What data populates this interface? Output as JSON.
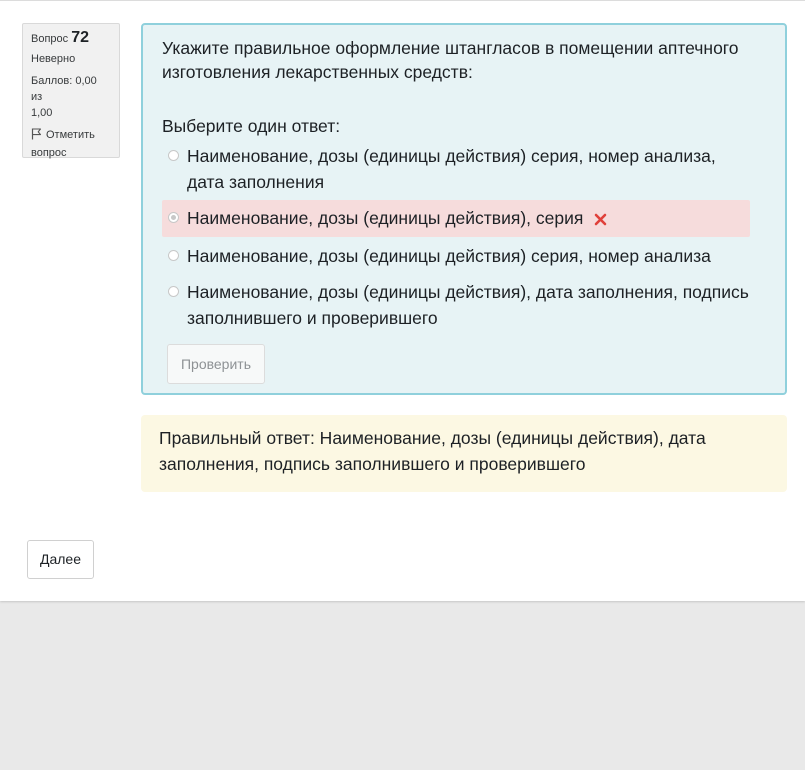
{
  "question_info": {
    "question_label": "Вопрос",
    "question_number": "72",
    "state": "Неверно",
    "grade_line1": "Баллов: 0,00 из",
    "grade_line2": "1,00",
    "flag_label_line1": "Отметить",
    "flag_label_line2": "вопрос",
    "flag_icon": "flag-icon"
  },
  "question": {
    "text": "Укажите правильное оформление штангласов в помещении аптечного изготовления лекарственных средств:",
    "prompt": "Выберите один ответ:",
    "answers": [
      {
        "label": "Наименование, дозы (единицы действия) серия, номер анализа, дата заполнения",
        "selected": false,
        "status": ""
      },
      {
        "label": "Наименование, дозы (единицы действия), серия",
        "selected": true,
        "status": "incorrect"
      },
      {
        "label": "Наименование, дозы (единицы действия) серия, номер анализа",
        "selected": false,
        "status": ""
      },
      {
        "label": "Наименование, дозы (единицы действия), дата заполнения, подпись заполнившего и проверившего",
        "selected": false,
        "status": ""
      }
    ],
    "check_button": "Проверить",
    "incorrect_icon": "cross-icon"
  },
  "feedback": {
    "right_answer": "Правильный ответ: Наименование, дозы (единицы действия), дата заполнения, подпись заполнившего и проверившего"
  },
  "navigation": {
    "next_button": "Далее"
  },
  "colors": {
    "formulation_bg": "#e7f3f5",
    "formulation_border": "#8fd0dc",
    "incorrect_bg": "#f6dcdc",
    "incorrect_mark": "#e0403a",
    "outcome_bg": "#fcf8e3"
  }
}
